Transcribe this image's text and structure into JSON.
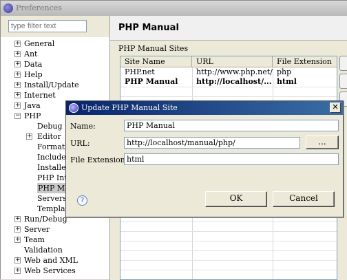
{
  "window": {
    "title": "Preferences"
  },
  "filter": {
    "placeholder": "type filter text"
  },
  "tree": {
    "items": [
      {
        "label": "General",
        "expander": "+"
      },
      {
        "label": "Ant",
        "expander": "+"
      },
      {
        "label": "Data",
        "expander": "+"
      },
      {
        "label": "Help",
        "expander": "+"
      },
      {
        "label": "Install/Update",
        "expander": "+"
      },
      {
        "label": "Internet",
        "expander": "+"
      },
      {
        "label": "Java",
        "expander": "+"
      },
      {
        "label": "PHP",
        "expander": "−"
      },
      {
        "label": "Debug",
        "expander": ""
      },
      {
        "label": "Editor",
        "expander": "+"
      },
      {
        "label": "Formatte",
        "expander": ""
      },
      {
        "label": "Include P",
        "expander": ""
      },
      {
        "label": "Installed",
        "expander": ""
      },
      {
        "label": "PHP Inte",
        "expander": ""
      },
      {
        "label": "PHP Ma",
        "expander": "",
        "selected": true
      },
      {
        "label": "Servers",
        "expander": ""
      },
      {
        "label": "Template",
        "expander": ""
      },
      {
        "label": "Run/Debug",
        "expander": "+"
      },
      {
        "label": "Server",
        "expander": "+"
      },
      {
        "label": "Team",
        "expander": "+"
      },
      {
        "label": "Validation",
        "expander": ""
      },
      {
        "label": "Web and XML",
        "expander": "+"
      },
      {
        "label": "Web Services",
        "expander": "+"
      }
    ]
  },
  "page": {
    "title": "PHP Manual",
    "sites_label": "PHP Manual Sites",
    "columns": [
      "Site Name",
      "URL",
      "File Extension"
    ],
    "rows": [
      {
        "name": "PHP.net",
        "url": "http://www.php.net/...",
        "ext": "php",
        "bold": false
      },
      {
        "name": "PHP Manual",
        "url": "http://localhost/...",
        "ext": "html",
        "bold": true
      }
    ]
  },
  "dialog": {
    "title": "Update PHP Manual Site",
    "close_glyph": "✕",
    "name_label": "Name:",
    "name_value": "PHP Manual",
    "url_label": "URL:",
    "url_value": "http://localhost/manual/php/",
    "browse_label": "...",
    "ext_label": "File Extension:",
    "ext_value": "html",
    "help_glyph": "?",
    "ok_label": "OK",
    "cancel_label": "Cancel"
  }
}
